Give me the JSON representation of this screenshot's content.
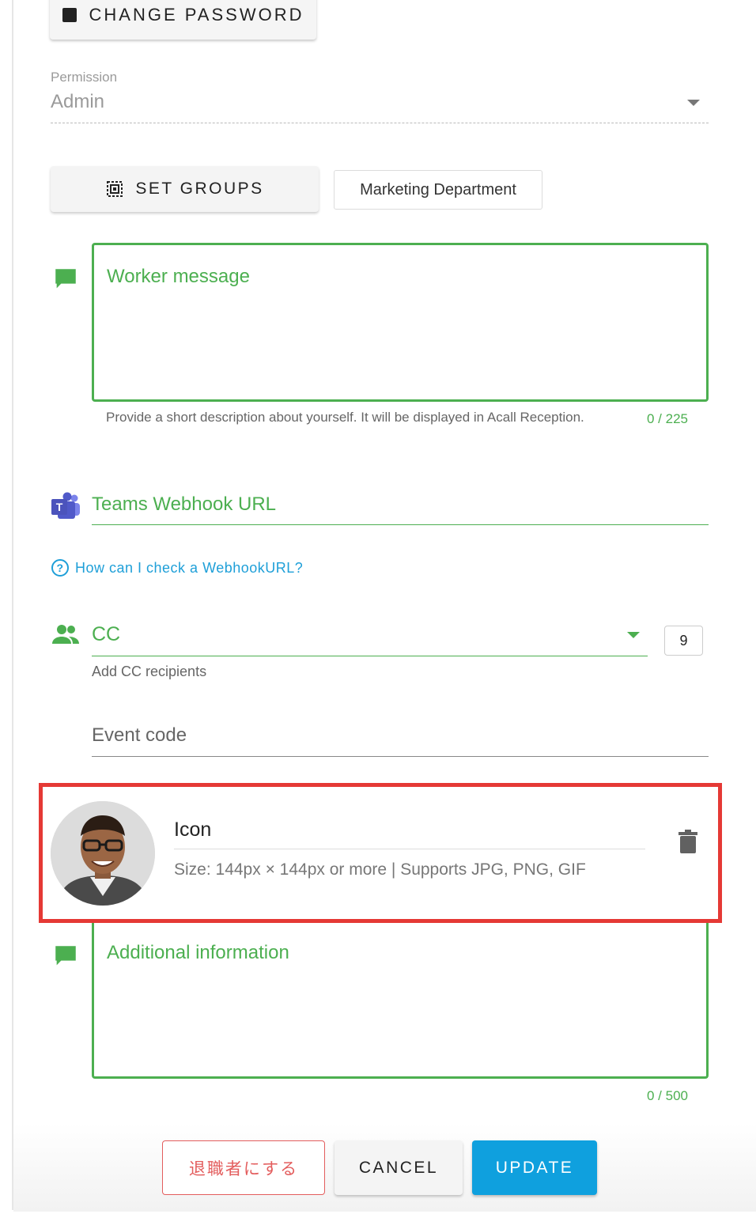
{
  "top_button": {
    "label": "CHANGE PASSWORD"
  },
  "permission": {
    "label": "Permission",
    "value": "Admin"
  },
  "groups": {
    "button_label": "SET GROUPS",
    "selected_group": "Marketing Department"
  },
  "worker_message": {
    "placeholder": "Worker message",
    "hint": "Provide a short description about yourself. It will be displayed in Acall Reception.",
    "counter": "0 / 225"
  },
  "teams": {
    "label": "Teams Webhook URL",
    "help_link": "How can I check a WebhookURL?"
  },
  "cc": {
    "label": "CC",
    "count": "9",
    "hint": "Add CC recipients"
  },
  "event_code": {
    "label": "Event code"
  },
  "icon_upload": {
    "title": "Icon",
    "requirements": "Size: 144px × 144px or more | Supports JPG, PNG, GIF"
  },
  "additional_info": {
    "placeholder": "Additional information",
    "counter": "0 / 500"
  },
  "actions": {
    "retire_label": "退職者にする",
    "cancel_label": "CANCEL",
    "update_label": "UPDATE"
  },
  "colors": {
    "accent_green": "#4caf50",
    "link_blue": "#1e9fd8",
    "primary": "#0fa0de",
    "danger": "#e35d5d",
    "highlight_border": "#e53935"
  }
}
